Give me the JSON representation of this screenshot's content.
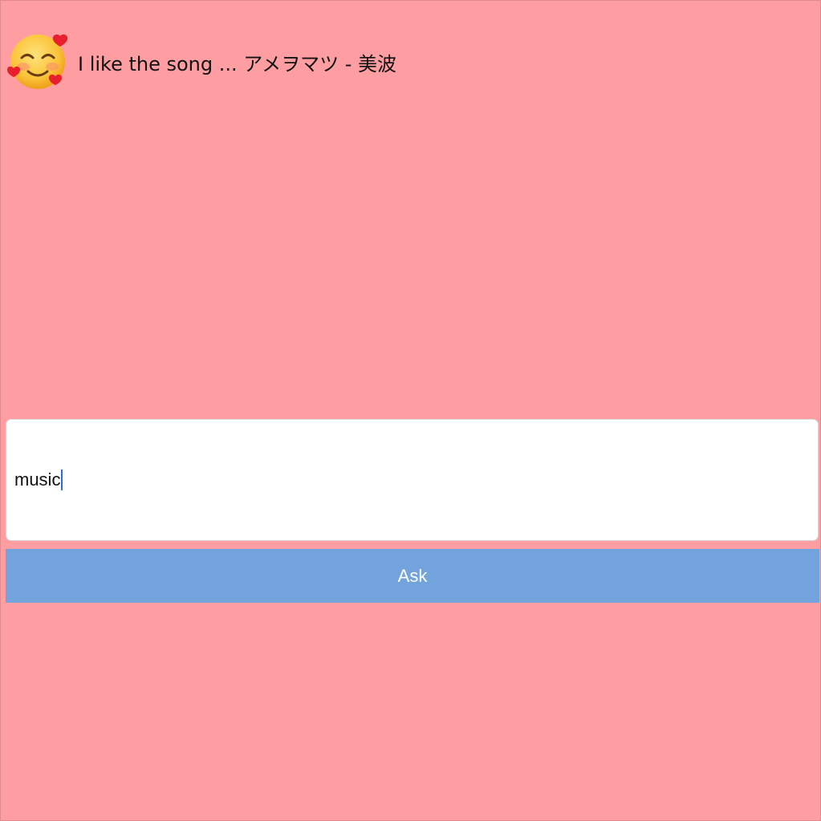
{
  "header": {
    "avatar_icon": "smiling-face-with-hearts-icon",
    "message": "I like the song ... アメヲマツ - 美波"
  },
  "input": {
    "value": "music"
  },
  "ask_button": {
    "label": "Ask"
  },
  "colors": {
    "background": "#ff9ea2",
    "button": "#72a3dc",
    "input_bg": "#ffffff"
  }
}
